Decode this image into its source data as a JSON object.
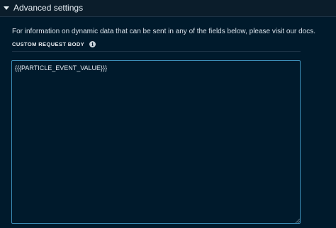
{
  "section": {
    "title": "Advanced settings",
    "expanded": true
  },
  "panel": {
    "info_text": "For information on dynamic data that can be sent in any of the fields below, please visit our docs.",
    "field_label": "CUSTOM REQUEST BODY",
    "info_icon": "info-icon",
    "body_value": "{{{PARTICLE_EVENT_VALUE}}}"
  },
  "colors": {
    "background": "#0b1d2b",
    "panel": "#001a2c",
    "field_border": "#3c8fb8"
  }
}
